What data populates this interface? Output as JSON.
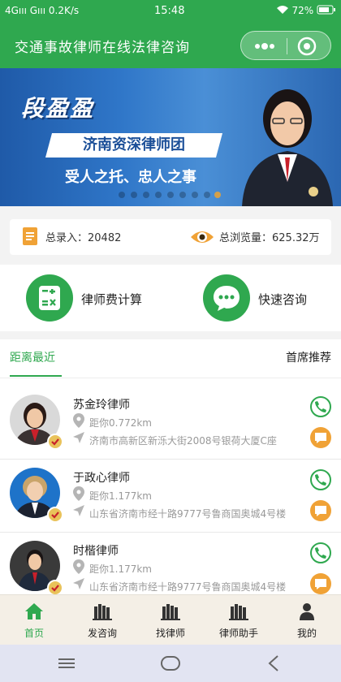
{
  "status_bar": {
    "left": "4Gııı Gııı 0.2K/s",
    "time": "15:48",
    "battery": "72%"
  },
  "app": {
    "title": "交通事故律师在线法律咨询",
    "accent": "#2fa84f"
  },
  "banner": {
    "name": "段盈盈",
    "team": "济南资深律师团",
    "slogan": "受人之托、忠人之事",
    "slides": 9,
    "active_slide": 9
  },
  "stats": {
    "total_label": "总录入：",
    "total_value": "20482",
    "views_label": "总浏览量：",
    "views_value": "625.32万"
  },
  "actions": {
    "fee_calc": "律师费计算",
    "quick_consult": "快速咨询"
  },
  "tabs": {
    "nearest": "距离最近",
    "recommended": "首席推荐"
  },
  "lawyers": [
    {
      "name": "苏金玲律师",
      "distance": "距你0.772km",
      "address": "济南市高新区新泺大街2008号银荷大厦C座"
    },
    {
      "name": "于政心律师",
      "distance": "距你1.177km",
      "address": "山东省济南市经十路9777号鲁商国奥城4号楼"
    },
    {
      "name": "时楷律师",
      "distance": "距你1.177km",
      "address": "山东省济南市经十路9777号鲁商国奥城4号楼"
    }
  ],
  "tabbar": {
    "items": [
      {
        "label": "首页",
        "icon": "home-icon"
      },
      {
        "label": "发咨询",
        "icon": "books-icon"
      },
      {
        "label": "找律师",
        "icon": "books-icon"
      },
      {
        "label": "律师助手",
        "icon": "books-icon"
      },
      {
        "label": "我的",
        "icon": "user-icon"
      }
    ]
  }
}
